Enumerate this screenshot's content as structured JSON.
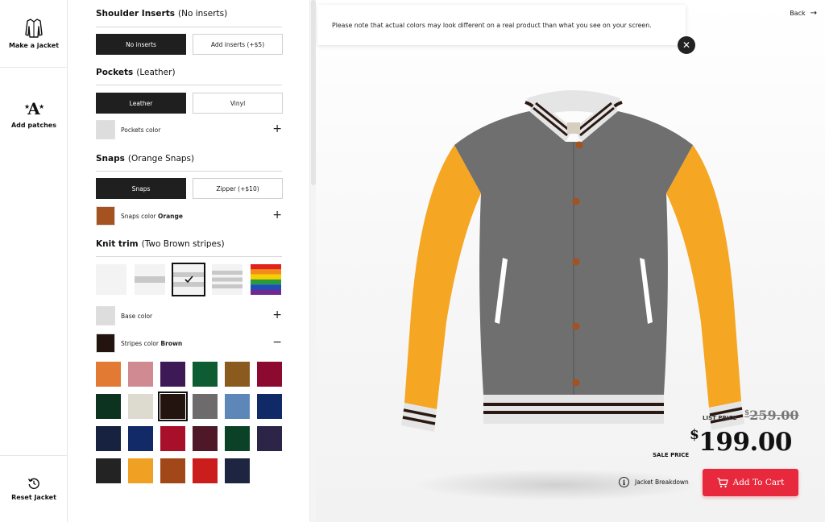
{
  "sidebar": {
    "make_jacket": "Make a jacket",
    "add_patches": "Add patches",
    "reset_jacket": "Reset Jacket"
  },
  "shoulder_inserts": {
    "title": "Shoulder Inserts",
    "selection": "(No inserts)",
    "options": [
      "No inserts",
      "Add inserts (+$5)"
    ],
    "selected_index": 0
  },
  "pockets": {
    "title": "Pockets",
    "selection": "(Leather)",
    "options": [
      "Leather",
      "Vinyl"
    ],
    "selected_index": 0,
    "color_label": "Pockets color",
    "color_swatch": "#dddddd"
  },
  "snaps": {
    "title": "Snaps",
    "selection": "(Orange Snaps)",
    "options": [
      "Snaps",
      "Zipper (+$10)"
    ],
    "selected_index": 0,
    "color_label": "Snaps color",
    "color_value": "Orange",
    "color_swatch": "#a4521f"
  },
  "knit_trim": {
    "title": "Knit trim",
    "selection": "(Two Brown stripes)",
    "patterns": [
      "plain",
      "one-stripe",
      "two-stripes",
      "three-stripes",
      "rainbow"
    ],
    "selected_index": 2,
    "base_color_label": "Base color",
    "base_color_swatch": "#dddddd",
    "stripes_color_label": "Stripes color",
    "stripes_color_value": "Brown",
    "stripes_color_swatch": "#24140f",
    "palette": [
      "#e27a34",
      "#cf8a92",
      "#3d1a55",
      "#0d5c32",
      "#8a5a1f",
      "#8c0a2f",
      "#0b3320",
      "#dddbcf",
      "#24140f",
      "#6d6b6b",
      "#5d87b9",
      "#0f2a66",
      "#16223f",
      "#122b68",
      "#a8102a",
      "#4e1828",
      "#0b4227",
      "#2c2548",
      "#232323",
      "#f0a124",
      "#a24718",
      "#cc1d1d",
      "#1e2541"
    ],
    "palette_selected_index": 8
  },
  "viewer": {
    "notice": "Please note that actual colors may look different on a real product than what you see on your screen.",
    "back_label": "Back",
    "list_price_label": "LIST PRICE",
    "list_price_currency": "$",
    "list_price": "259.00",
    "sale_price_label": "SALE PRICE",
    "sale_price_currency": "$",
    "sale_price": "199.00",
    "breakdown_label": "Jacket Breakdown",
    "cart_label": "Add To Cart"
  },
  "jacket_colors": {
    "body": "#6f6f6f",
    "sleeves": "#f5a623",
    "knit_base": "#dddddd",
    "knit_stripes": "#2a1812",
    "snaps": "#a4521f",
    "pockets": "#ffffff"
  }
}
